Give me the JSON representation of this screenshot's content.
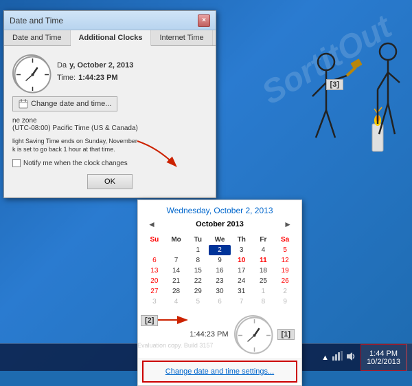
{
  "window": {
    "title": "Date and Time",
    "close_label": "×",
    "tabs": [
      {
        "label": "Date and Time",
        "active": false
      },
      {
        "label": "Additional Clocks",
        "active": false
      },
      {
        "label": "Internet Time",
        "active": false
      }
    ]
  },
  "dialog": {
    "date_label": "Da",
    "date_value": "y, October 2, 2013",
    "time_label": "Time:",
    "time_value": "1:44:23 PM",
    "timezone_label": "(UTC-08:00) Pacific Time (US & Canada)",
    "dst_notice": "light Saving Time ends on Sunday, November\nk is set to go back 1 hour at that time.",
    "notify_label": "Notify me when the clock changes",
    "change_btn_label": "Change date and time...",
    "ok_label": "OK"
  },
  "calendar": {
    "date_title": "Wednesday, October 2, 2013",
    "month_label": "October 2013",
    "days_header": [
      "Su",
      "Mo",
      "Tu",
      "We",
      "Th",
      "Fr",
      "Sa"
    ],
    "weeks": [
      [
        "",
        "",
        "1",
        "2",
        "3",
        "4",
        "5"
      ],
      [
        "6",
        "7",
        "8",
        "9",
        "10",
        "11",
        "12"
      ],
      [
        "13",
        "14",
        "15",
        "16",
        "17",
        "18",
        "19"
      ],
      [
        "20",
        "21",
        "22",
        "23",
        "24",
        "25",
        "26"
      ],
      [
        "27",
        "28",
        "29",
        "30",
        "31",
        "1",
        "2"
      ],
      [
        "3",
        "4",
        "5",
        "6",
        "7",
        "8",
        "9"
      ]
    ],
    "today_day": "2",
    "weekend_indices": [
      0,
      6
    ],
    "time_display": "1:44:23 PM",
    "change_settings_label": "Change date and time settings...",
    "labels": {
      "one": "[1]",
      "two": "[2]",
      "three": "[3]"
    }
  },
  "taskbar": {
    "time_line1": "1:44 PM",
    "time_line2": "10/2/2013",
    "icons": [
      "▲",
      "",
      "",
      ""
    ]
  },
  "build_label": "Evaluation copy. Build 3157"
}
